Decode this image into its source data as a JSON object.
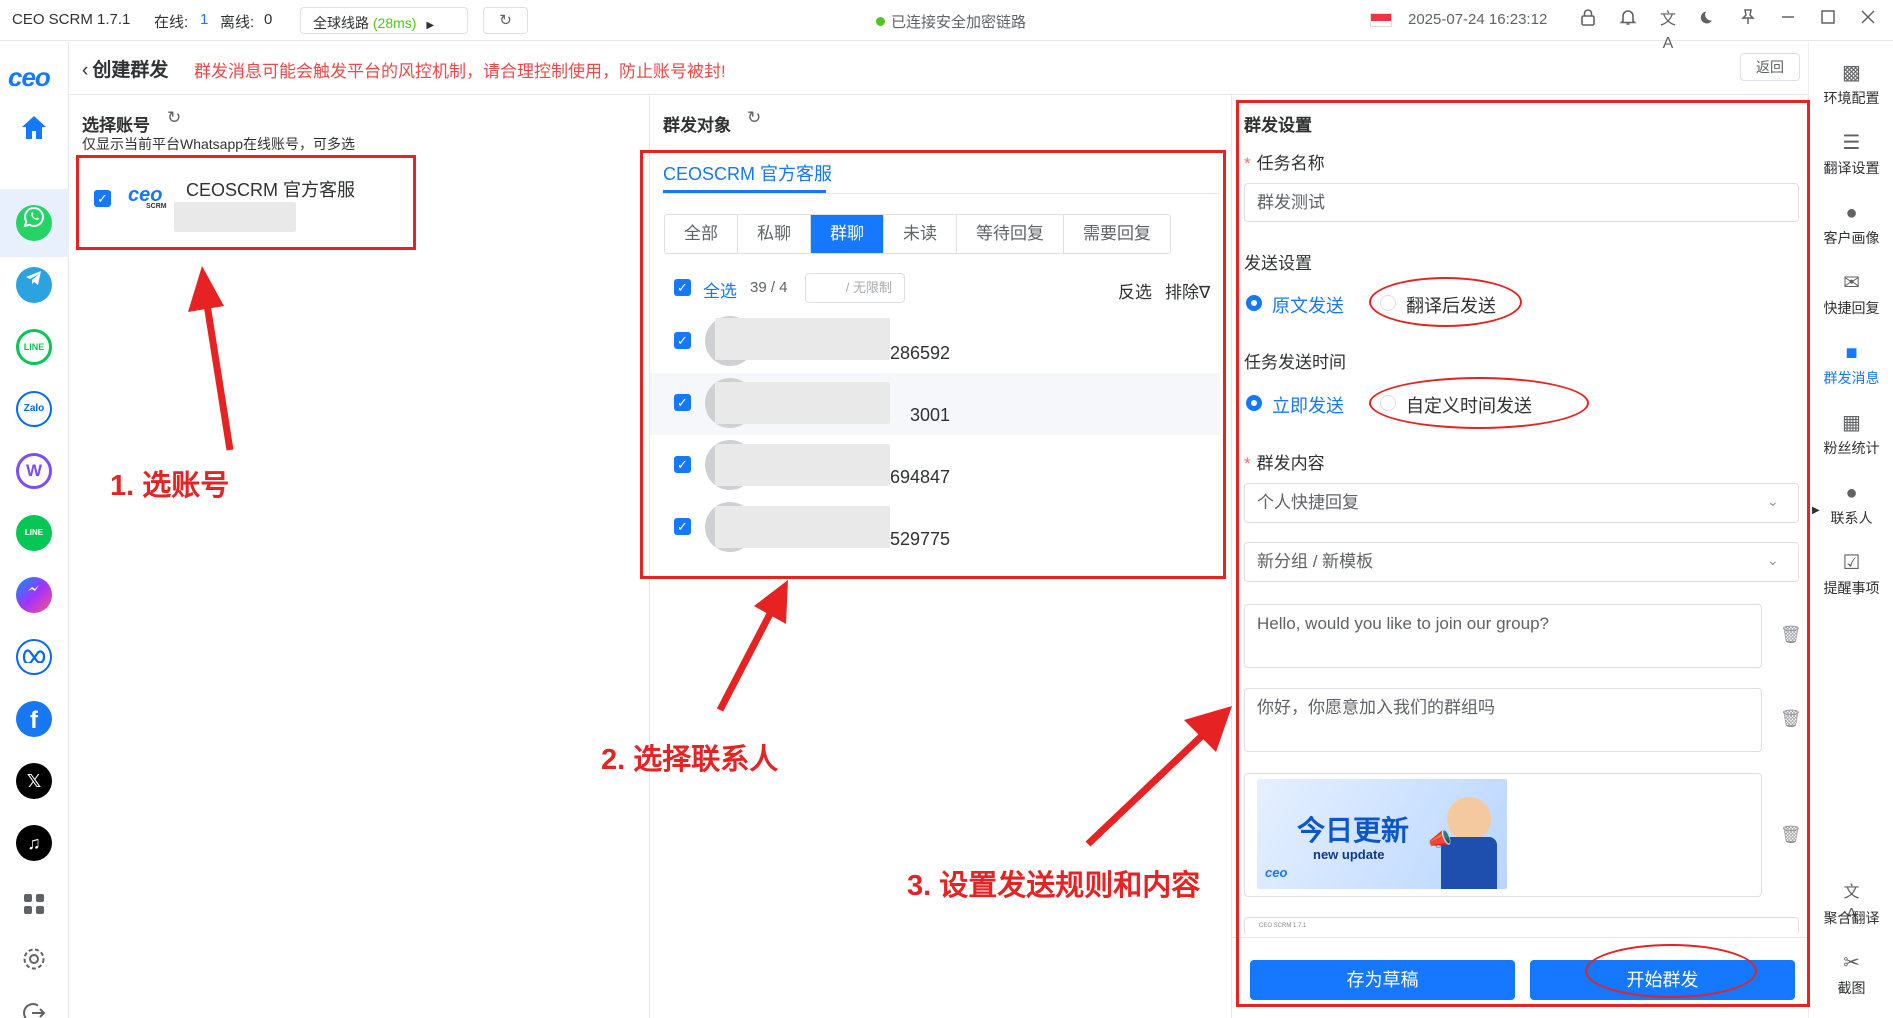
{
  "titlebar": {
    "app_name": "CEO SCRM 1.7.1",
    "online_label": "在线:",
    "online_count": "1",
    "offline_label": "离线:",
    "offline_count": "0",
    "route_label": "全球线路",
    "route_latency": "(28ms)",
    "connection_status": "已连接安全加密链路",
    "datetime": "2025-07-24 16:23:12"
  },
  "header": {
    "back_label": "创建群发",
    "warning": "群发消息可能会触发平台的风控机制，请合理控制使用，防止账号被封!",
    "return_label": "返回"
  },
  "left_sidebar": {
    "logo": "ceo",
    "items": [
      "home-icon",
      "whatsapp-icon",
      "telegram-icon",
      "line-icon",
      "zalo-icon",
      "w-app-icon",
      "line-alt-icon",
      "messenger-icon",
      "meta-icon",
      "facebook-icon",
      "x-icon",
      "tiktok-icon",
      "apps-icon",
      "settings-icon",
      "logout-icon"
    ],
    "zalo_text": "Zalo",
    "line_text": "LINE"
  },
  "accounts": {
    "title": "选择账号",
    "hint": "仅显示当前平台Whatsapp在线账号，可多选",
    "items": [
      {
        "name": "CEOSCRM 官方客服",
        "logo": "ceo",
        "logo_sub": "SCRM",
        "checked": true
      }
    ]
  },
  "targets": {
    "title": "群发对象",
    "account_tab": "CEOSCRM 官方客服",
    "filter_tabs": [
      "全部",
      "私聊",
      "群聊",
      "未读",
      "等待回复",
      "需要回复"
    ],
    "active_tab": "群聊",
    "select_all": "全选",
    "count": "39 / 4",
    "limit_placeholder": "/ 无限制",
    "invert": "反选",
    "exclude": "排除",
    "contacts": [
      "286592",
      "3001",
      "694847",
      "529775"
    ]
  },
  "settings": {
    "title": "群发设置",
    "task_name_label": "任务名称",
    "task_name_value": "群发测试",
    "send_setting_label": "发送设置",
    "send_options": [
      "原文发送",
      "翻译后发送"
    ],
    "send_time_label": "任务发送时间",
    "time_options": [
      "立即发送",
      "自定义时间发送"
    ],
    "content_label": "群发内容",
    "quick_reply_select": "个人快捷回复",
    "template_select": "新分组 / 新模板",
    "messages": [
      "Hello, would you like to join our group?",
      "你好，你愿意加入我们的群组吗"
    ],
    "image_title": "今日更新",
    "image_subtitle": "new update",
    "image_logo": "ceo",
    "preview_caption": "CEO SCRM 1.7.1",
    "draft_button": "存为草稿",
    "start_button": "开始群发"
  },
  "right_sidebar": {
    "items": [
      {
        "label": "环境配置",
        "icon": "environment-icon"
      },
      {
        "label": "翻译设置",
        "icon": "translate-settings-icon"
      },
      {
        "label": "客户画像",
        "icon": "customer-profile-icon"
      },
      {
        "label": "快捷回复",
        "icon": "quick-reply-icon"
      },
      {
        "label": "群发消息",
        "icon": "broadcast-icon"
      },
      {
        "label": "粉丝统计",
        "icon": "fans-stats-icon"
      },
      {
        "label": "联系人",
        "icon": "contacts-icon"
      },
      {
        "label": "提醒事项",
        "icon": "reminder-icon"
      },
      {
        "label": "聚合翻译",
        "icon": "aggregate-translate-icon"
      },
      {
        "label": "截图",
        "icon": "screenshot-icon"
      }
    ],
    "active": "群发消息"
  },
  "annotations": {
    "step1": "1. 选账号",
    "step2": "2. 选择联系人",
    "step3": "3. 设置发送规则和内容"
  },
  "colors": {
    "accent": "#1677ff",
    "annotation_red": "#e62222",
    "warning_red": "#f04848",
    "online_green": "#52c41a"
  }
}
